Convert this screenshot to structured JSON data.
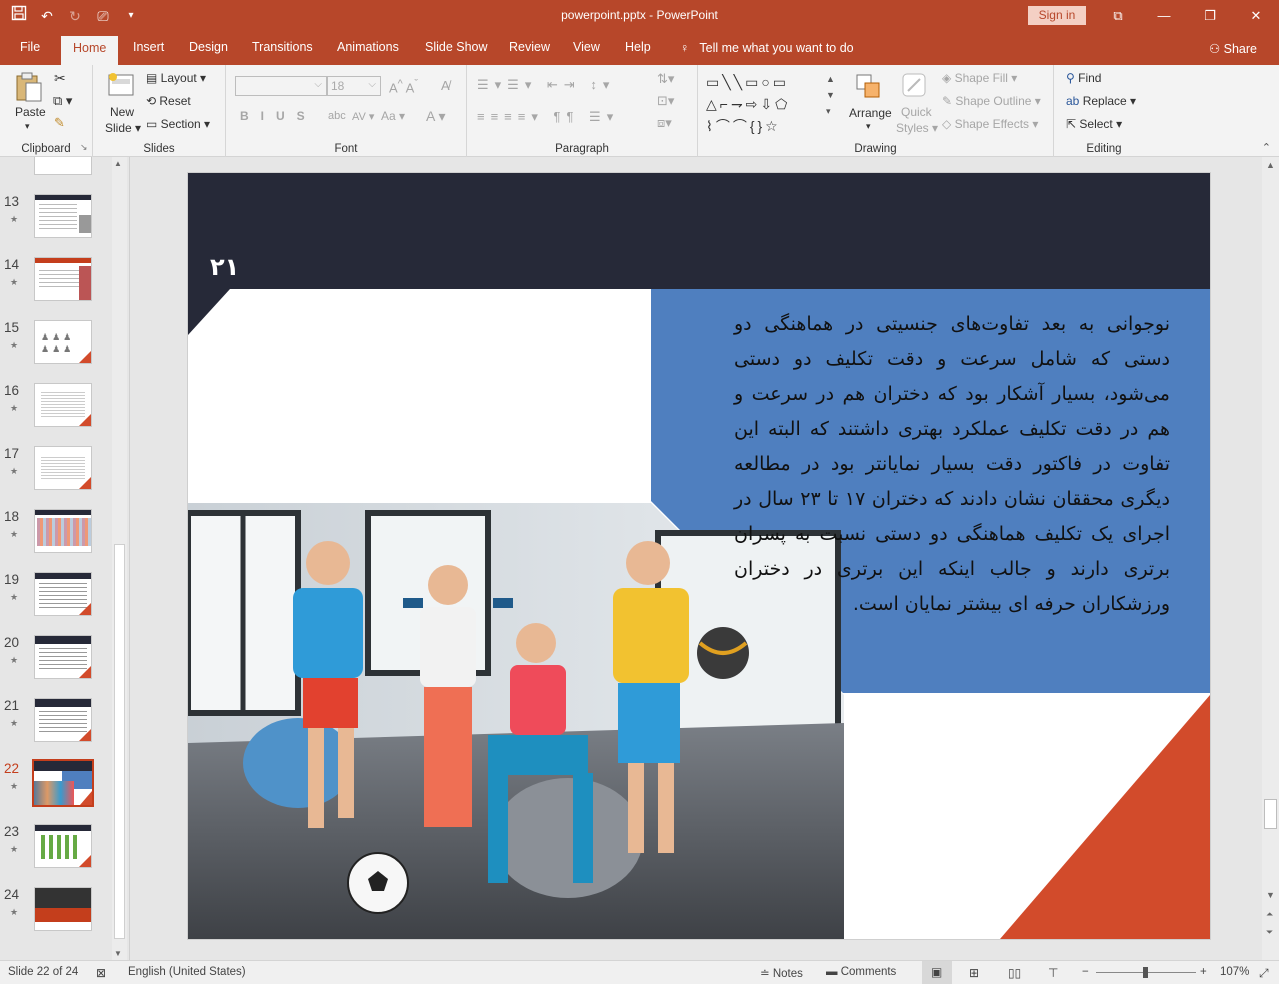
{
  "window": {
    "title": "powerpoint.pptx  -  PowerPoint",
    "signin": "Sign in"
  },
  "tabs": [
    "File",
    "Home",
    "Insert",
    "Design",
    "Transitions",
    "Animations",
    "Slide Show",
    "Review",
    "View",
    "Help"
  ],
  "tellme": "Tell me what you want to do",
  "share": "Share",
  "ribbon": {
    "clipboard": {
      "label": "Clipboard",
      "paste": "Paste"
    },
    "slides": {
      "label": "Slides",
      "new_slide_1": "New",
      "new_slide_2": "Slide",
      "layout": "Layout",
      "reset": "Reset",
      "section": "Section"
    },
    "font": {
      "label": "Font",
      "size": "18"
    },
    "paragraph": {
      "label": "Paragraph"
    },
    "drawing": {
      "label": "Drawing",
      "arrange": "Arrange",
      "quick_styles_1": "Quick",
      "quick_styles_2": "Styles",
      "shape_fill": "Shape Fill",
      "shape_outline": "Shape Outline",
      "shape_effects": "Shape Effects"
    },
    "editing": {
      "label": "Editing",
      "find": "Find",
      "replace": "Replace",
      "select": "Select"
    }
  },
  "thumbnails": [
    "13",
    "14",
    "15",
    "16",
    "17",
    "18",
    "19",
    "20",
    "21",
    "22",
    "23",
    "24"
  ],
  "selected_slide": "22",
  "slide": {
    "page_number": "۲۱",
    "body": "نوجوانی به بعد تفاوت‌های جنسیتی در هماهنگی دو دستی که شامل سرعت و دقت تکلیف دو دستی می‌شود، بسیار آشکار بود که دختران هم در سرعت و هم در دقت تکلیف عملکرد بهتری داشتند که البته این تفاوت در فاکتور دقت بسیار نمایانتر بود در مطالعه دیگری محققان نشان دادند که دختران ۱۷ تا ۲۳ سال در اجرای یک تکلیف هماهنگی دو دستی نسبت به پسران برتری دارند و جالب اینکه این برتری در دختران ورزشکاران حرفه ای بیشتر نمایان است."
  },
  "status": {
    "slide_info": "Slide 22 of 24",
    "language": "English (United States)",
    "notes": "Notes",
    "comments": "Comments",
    "zoom": "107%"
  },
  "colors": {
    "accent": "#b7472a",
    "slide_dark": "#262938",
    "slide_blue": "#4f7fbf",
    "slide_red": "#d24b2b"
  }
}
